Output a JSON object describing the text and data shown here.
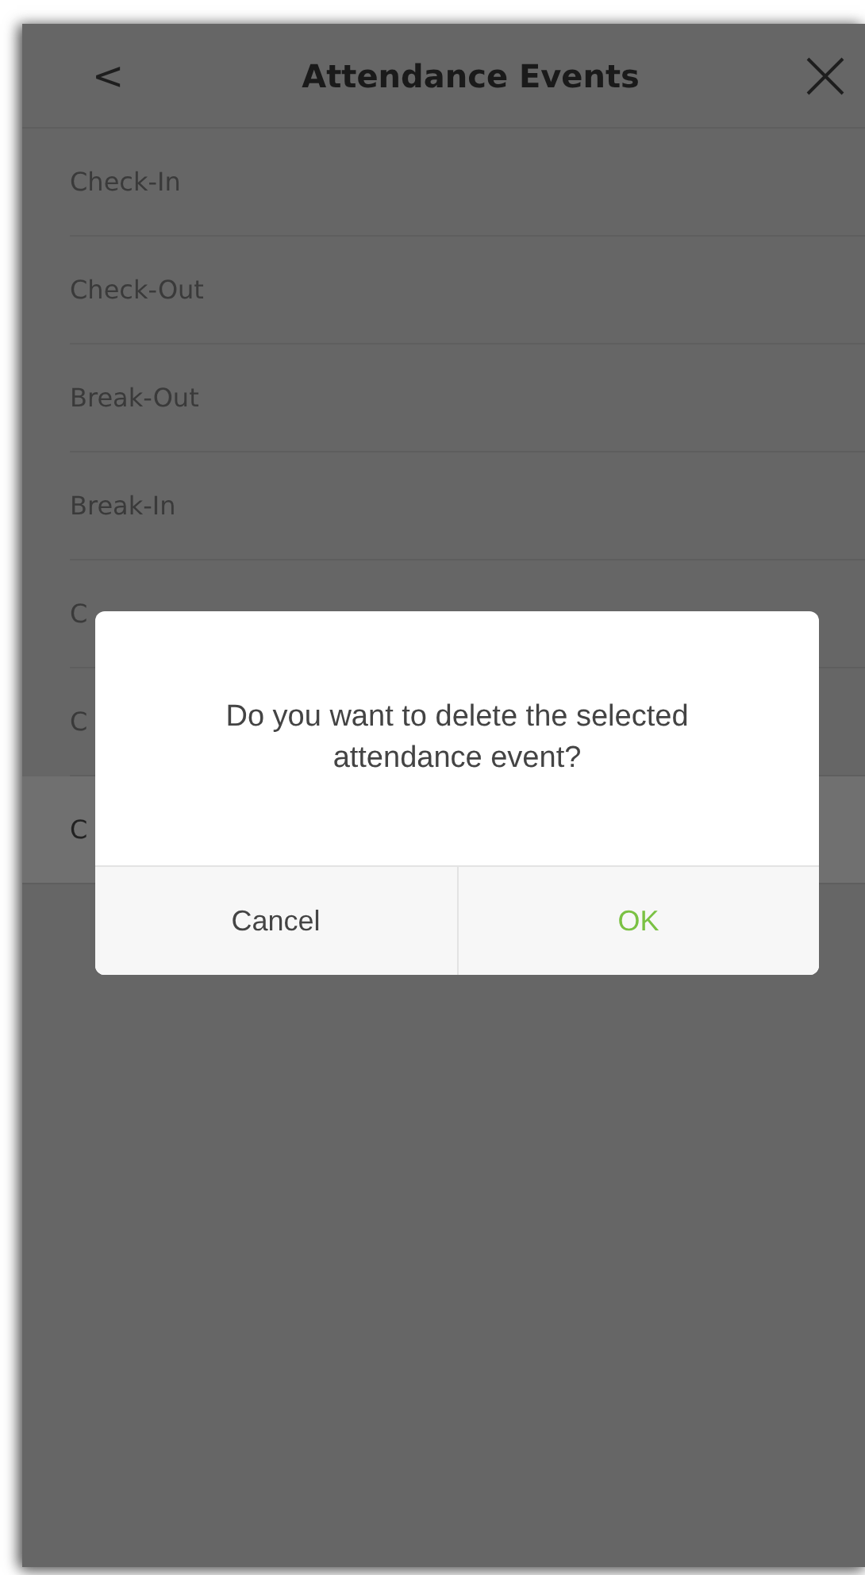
{
  "header": {
    "back": "<",
    "title": "Attendance Events"
  },
  "events": [
    {
      "label": "Check-In",
      "selected": false
    },
    {
      "label": "Check-Out",
      "selected": false
    },
    {
      "label": "Break-Out",
      "selected": false
    },
    {
      "label": "Break-In",
      "selected": false
    },
    {
      "label": "C",
      "selected": false
    },
    {
      "label": "C",
      "selected": false
    },
    {
      "label": "C",
      "selected": true
    }
  ],
  "dialog": {
    "message": "Do you want to delete the selected attendance event?",
    "buttons": [
      {
        "label": "Cancel",
        "kind": "cancel"
      },
      {
        "label": "OK",
        "kind": "confirm"
      }
    ]
  }
}
